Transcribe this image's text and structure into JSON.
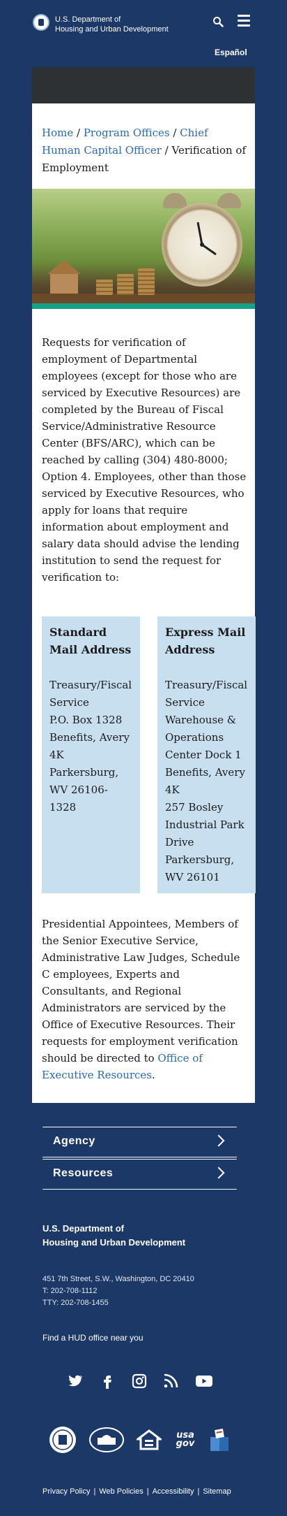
{
  "header": {
    "org_line1": "U.S. Department of",
    "org_line2": "Housing and Urban Development",
    "search_icon": "search-icon",
    "menu_icon": "hamburger-menu-icon",
    "language_link": "Español"
  },
  "breadcrumb": {
    "items": [
      "Home",
      "Program Offices",
      "Chief Human Capital Officer"
    ],
    "separator": " / ",
    "current": "Verification of Employment"
  },
  "content": {
    "intro": "Requests for verification of employment of Departmental employees (except for those who are serviced by Executive Resources) are completed by the Bureau of Fiscal Service/Administrative Resource Center (BFS/ARC), which can be reached by calling (304) 480-8000; Option 4. Employees, other than those serviced by Executive Resources, who apply for loans that require information about employment and salary data should advise the lending institution to send the request for verification to:",
    "standard_mail": {
      "title": "Standard Mail Address",
      "lines": [
        "Treasury/Fiscal Service",
        "P.O. Box 1328",
        "Benefits, Avery 4K",
        "Parkersburg, WV 26106-1328"
      ]
    },
    "express_mail": {
      "title": "Express Mail Address",
      "lines": [
        "Treasury/Fiscal Service",
        "Warehouse & Operations Center Dock 1",
        "Benefits, Avery 4K",
        "257 Bosley Industrial Park Drive",
        "Parkersburg, WV 26101"
      ]
    },
    "closing": "Presidential Appointees, Members of the Senior Executive Service, Administrative Law Judges, Schedule C employees, Experts and Consultants, and Regional Administrators are serviced by the Office of Executive Resources. Their requests for employment verification should be directed to ",
    "closing_link": "Office of Executive Resources",
    "closing_end": "."
  },
  "footer": {
    "accordion": [
      "Agency",
      "Resources"
    ],
    "org_line1": "U.S. Department of",
    "org_line2": "Housing and Urban Development",
    "address": "451 7th Street, S.W., Washington, DC 20410",
    "phone": "T: 202-708-1112",
    "tty": "TTY: 202-708-1455",
    "find_office": "Find a HUD office near you",
    "social_icons": [
      "twitter-icon",
      "facebook-icon",
      "instagram-icon",
      "rss-icon",
      "youtube-icon"
    ],
    "partner_logos": [
      "hud-seal-logo",
      "white-house-logo",
      "equal-housing-logo",
      "usa-gov-logo",
      "vote-logo"
    ],
    "usa_gov_text": "usa gov",
    "links": [
      "Privacy Policy",
      "Web Policies",
      "Accessibility",
      "Sitemap"
    ]
  },
  "colors": {
    "background": "#1c3867",
    "link": "#2a6ab0",
    "address_box": "#c8dff0",
    "dark_bar": "#2d3134"
  }
}
